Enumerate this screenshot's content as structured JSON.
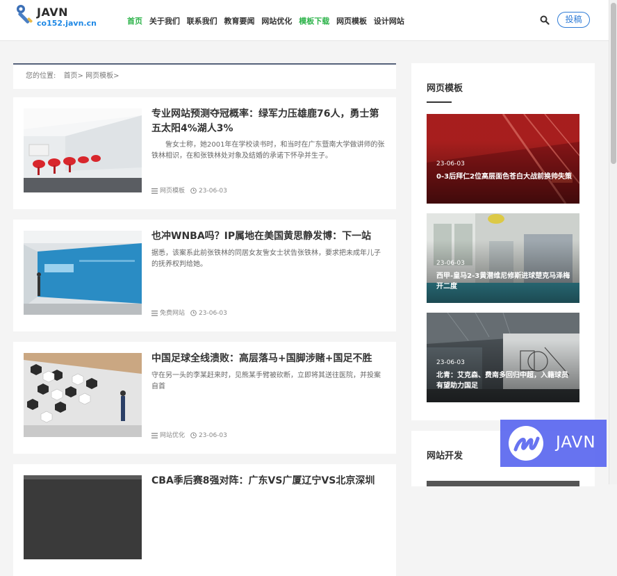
{
  "site": {
    "logo_title": "JAVN",
    "logo_sub": "co152.javn.cn"
  },
  "nav": {
    "items": [
      {
        "label": "首页",
        "active": true
      },
      {
        "label": "关于我们"
      },
      {
        "label": "联系我们"
      },
      {
        "label": "教育要闻"
      },
      {
        "label": "网站优化"
      },
      {
        "label": "模板下载",
        "highlight": true
      },
      {
        "label": "网页模板"
      },
      {
        "label": "设计网站"
      }
    ],
    "submit_label": "投稿"
  },
  "breadcrumb": {
    "prefix": "您的位置:",
    "home": "首页>",
    "current": "网页模板>"
  },
  "articles": [
    {
      "title": "专业网站预测夺冠概率：绿军力压雄鹿76人，勇士第五太阳4%湖人3%",
      "summary": "　　訾女士称，她2001年在学校读书时，和当时在广东暨南大学做讲师的张铁林相识，在和张铁林处对象及结婚的承诺下怀孕并生子。",
      "category": "网页模板",
      "date": "23-06-03"
    },
    {
      "title": "也冲WNBA吗？IP属地在美国黄思静发博：下一站",
      "summary": "据悉，该案系此前张铁林的同居女友訾女士状告张铁林，要求把未成年儿子的抚养权判给她。",
      "category": "免费网站",
      "date": "23-06-03"
    },
    {
      "title": "中国足球全线溃败：高层落马+国脚涉赌+国足不胜",
      "summary": "守在另一头的李某赶来时，见熊某手臂被砍断，立即将其送往医院，并投案自首",
      "category": "网站优化",
      "date": "23-06-03"
    },
    {
      "title": "CBA季后赛8强对阵：广东VS广厦辽宁VS北京深圳",
      "summary": "",
      "category": "",
      "date": ""
    }
  ],
  "sidebar": {
    "section1_title": "网页模板",
    "cards": [
      {
        "date": "23-06-03",
        "title": "0-3后拜仁2位高层面色苍白大战前换帅失策"
      },
      {
        "date": "23-06-03",
        "title": "西甲-皇马2-3黄潜维尼修斯进球楚克马泽梅开二度"
      },
      {
        "date": "23-06-03",
        "title": "北青：艾克森、费南多回归中超，入籍球员有望助力国足"
      }
    ],
    "section2_title": "网站开发"
  },
  "watermark": {
    "text": "JAVN"
  },
  "colors": {
    "nav_green": "#2db34a",
    "accent_blue": "#2e7bd6",
    "watermark": "#5f6cf0"
  }
}
